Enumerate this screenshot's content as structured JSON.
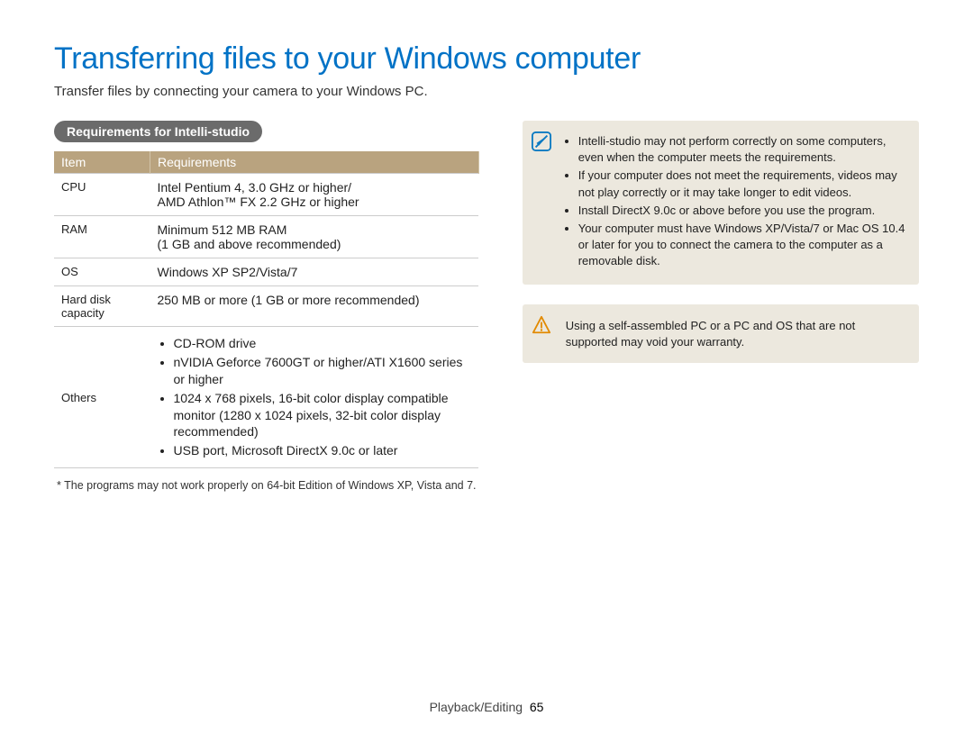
{
  "title": "Transferring files to your Windows computer",
  "subtitle": "Transfer files by connecting your camera to your Windows PC.",
  "left": {
    "heading": "Requirements for Intelli-studio",
    "table": {
      "headers": {
        "item": "Item",
        "req": "Requirements"
      },
      "rows": [
        {
          "item": "CPU",
          "req_lines": [
            "Intel Pentium 4, 3.0 GHz or higher/",
            "AMD Athlon™ FX 2.2 GHz or higher"
          ]
        },
        {
          "item": "RAM",
          "req_lines": [
            "Minimum 512 MB RAM",
            "(1 GB and above recommended)"
          ]
        },
        {
          "item": "OS",
          "req_lines": [
            "Windows XP SP2/Vista/7"
          ]
        },
        {
          "item": "Hard disk capacity",
          "req_lines": [
            "250 MB or more (1 GB or more recommended)"
          ]
        },
        {
          "item": "Others",
          "req_bullets": [
            "CD-ROM drive",
            "nVIDIA Geforce 7600GT or higher/ATI X1600 series or higher",
            "1024 x 768 pixels, 16-bit color display compatible monitor (1280 x 1024 pixels, 32-bit color display recommended)",
            "USB port, Microsoft DirectX 9.0c or later"
          ]
        }
      ]
    },
    "footnote": "* The programs may not work properly on 64-bit Edition of Windows XP, Vista and 7."
  },
  "right": {
    "note": {
      "icon_name": "note-icon",
      "items": [
        "Intelli-studio may not perform correctly on some computers, even when the computer meets the requirements.",
        "If your computer does not meet the requirements, videos may not play correctly or it may take longer to edit videos.",
        "Install DirectX 9.0c or above before you use the program.",
        "Your computer must have Windows XP/Vista/7 or Mac OS 10.4 or later for you to connect the camera to the computer as a removable disk."
      ]
    },
    "warning": {
      "icon_name": "warning-icon",
      "text": "Using a self-assembled PC or a PC and OS that are not supported may void your warranty."
    }
  },
  "footer": {
    "section": "Playback/Editing",
    "page": "65"
  }
}
